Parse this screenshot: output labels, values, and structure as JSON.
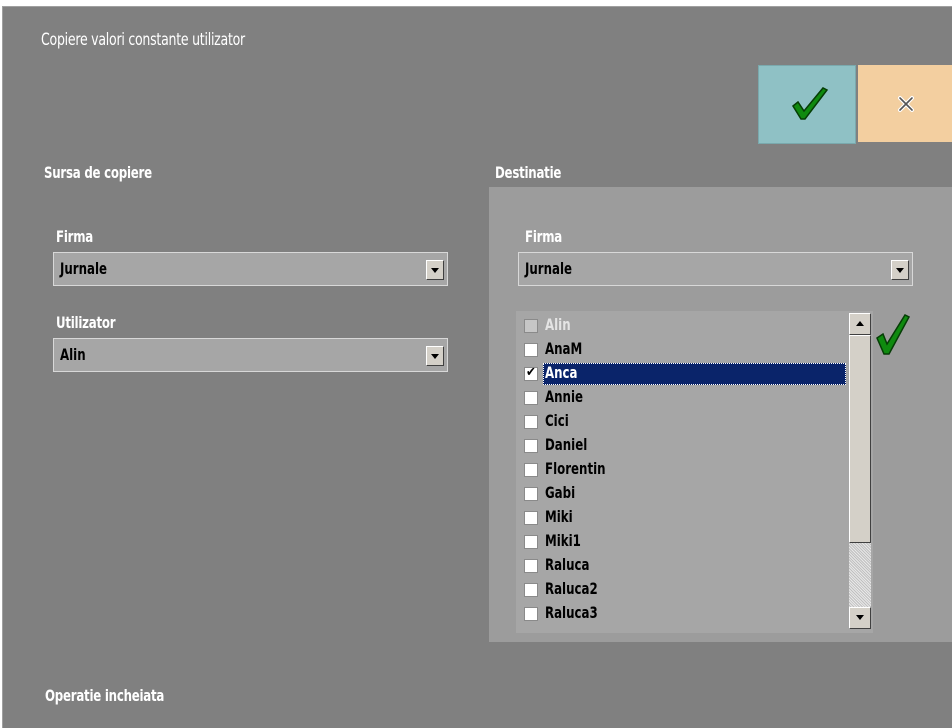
{
  "window": {
    "title": "Copiere valori constante utilizator"
  },
  "toolbar": {
    "ok_icon": "checkmark-icon",
    "cancel_icon": "close-icon",
    "ok_color": "#8fc1c5",
    "cancel_color": "#f3cfa0"
  },
  "source": {
    "heading": "Sursa de copiere",
    "firma_label": "Firma",
    "firma_value": "Jurnale",
    "user_label": "Utilizator",
    "user_value": "Alin"
  },
  "destination": {
    "heading": "Destinatie",
    "firma_label": "Firma",
    "firma_value": "Jurnale",
    "select_all_icon": "checkmark-icon",
    "users": [
      {
        "label": "Alin",
        "checked": false,
        "disabled": true,
        "selected": false
      },
      {
        "label": "AnaM",
        "checked": false,
        "disabled": false,
        "selected": false
      },
      {
        "label": "Anca",
        "checked": true,
        "disabled": false,
        "selected": true
      },
      {
        "label": "Annie",
        "checked": false,
        "disabled": false,
        "selected": false
      },
      {
        "label": "Cici",
        "checked": false,
        "disabled": false,
        "selected": false
      },
      {
        "label": "Daniel",
        "checked": false,
        "disabled": false,
        "selected": false
      },
      {
        "label": "Florentin",
        "checked": false,
        "disabled": false,
        "selected": false
      },
      {
        "label": "Gabi",
        "checked": false,
        "disabled": false,
        "selected": false
      },
      {
        "label": "Miki",
        "checked": false,
        "disabled": false,
        "selected": false
      },
      {
        "label": "Miki1",
        "checked": false,
        "disabled": false,
        "selected": false
      },
      {
        "label": "Raluca",
        "checked": false,
        "disabled": false,
        "selected": false
      },
      {
        "label": "Raluca2",
        "checked": false,
        "disabled": false,
        "selected": false
      },
      {
        "label": "Raluca3",
        "checked": false,
        "disabled": false,
        "selected": false
      }
    ]
  },
  "status": {
    "text": "Operatie incheiata"
  }
}
